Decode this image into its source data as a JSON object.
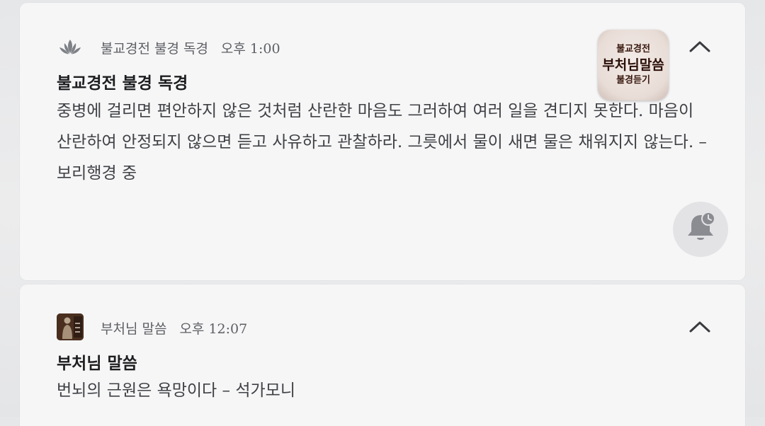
{
  "notifications": [
    {
      "app_name": "불교경전 불경 독경",
      "time": "오후 1:00",
      "title": "불교경전 불경 독경",
      "body": "중병에 걸리면 편안하지 않은 것처럼 산란한 마음도 그러하여 여러 일을 견디지 못한다. 마음이 산란하여 안정되지 않으면 듣고 사유하고 관찰하라. 그릇에서 물이 새면 물은 채워지지 않는다.  –  보리행경 중",
      "app_icon": "lotus-icon",
      "large_icon": {
        "line1": "불교경전",
        "line2": "부처님말씀",
        "line3": "불경듣기"
      },
      "expand_icon": "chevron-up-icon",
      "snooze_icon": "bell-snooze-icon"
    },
    {
      "app_name": "부처님 말씀",
      "time": "오후 12:07",
      "title": "부처님 말씀",
      "body": "번뇌의 근원은 욕망이다 – 석가모니",
      "app_icon": "buddha-statue-icon",
      "expand_icon": "chevron-up-icon"
    }
  ],
  "colors": {
    "background": "#e8e9eb",
    "card": "#f6f6f7",
    "title_text": "#1d1e20",
    "body_text": "#3f4145",
    "meta_text": "#5d5f63",
    "icon_gray": "#808389"
  }
}
